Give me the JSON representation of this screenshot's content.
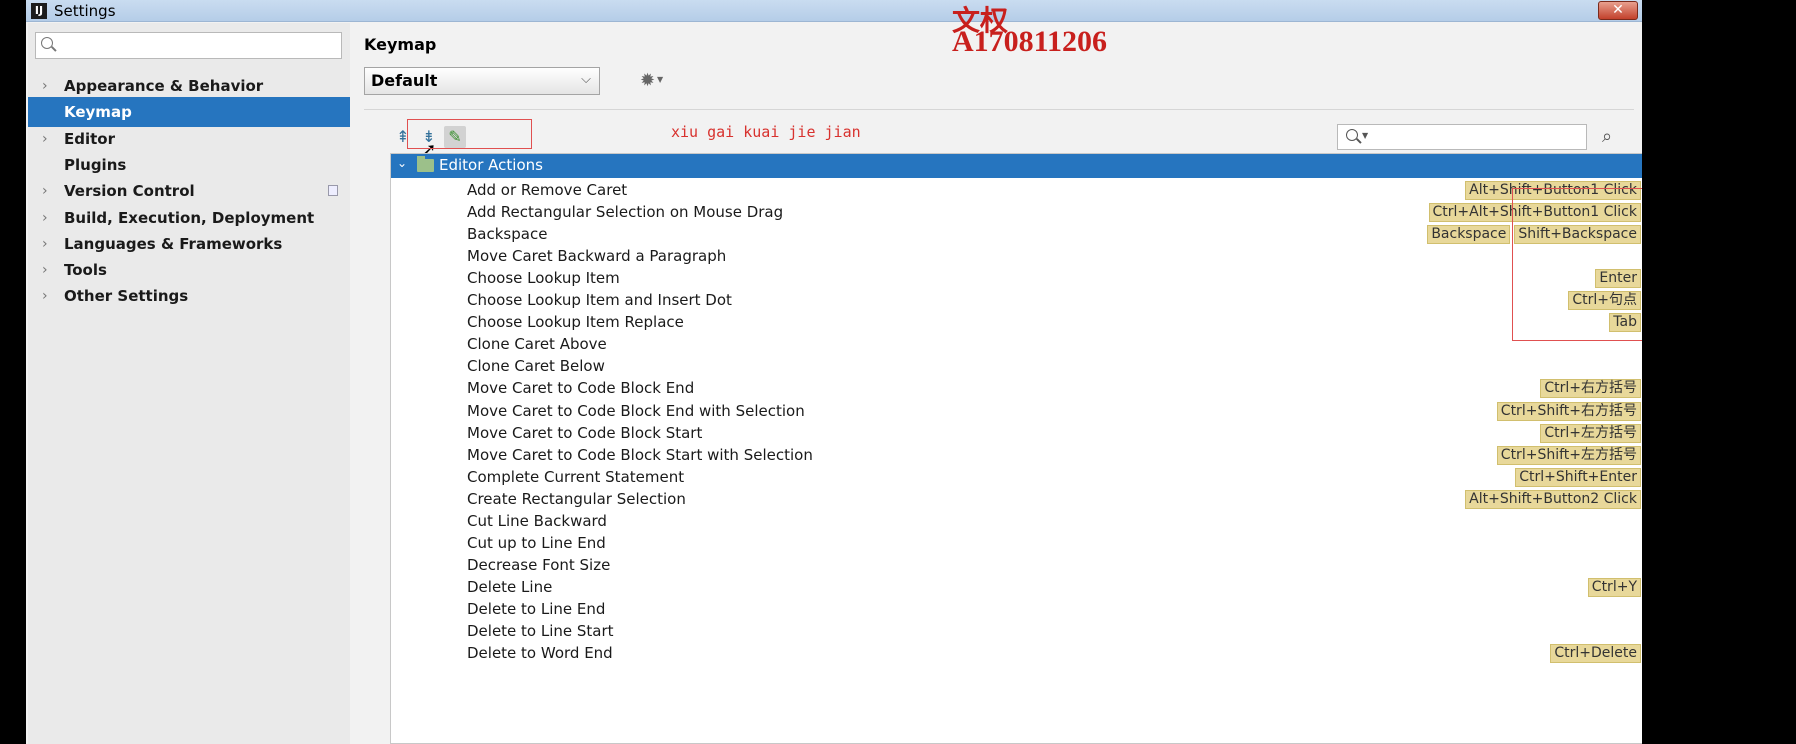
{
  "window": {
    "title": "Settings",
    "app_icon": "IJ",
    "close_glyph": "✕"
  },
  "sidebar": {
    "search_placeholder": "",
    "items": [
      {
        "label": "Appearance & Behavior",
        "expandable": true
      },
      {
        "label": "Keymap",
        "expandable": false,
        "selected": true
      },
      {
        "label": "Editor",
        "expandable": true
      },
      {
        "label": "Plugins",
        "expandable": false
      },
      {
        "label": "Version Control",
        "expandable": true
      },
      {
        "label": "Build, Execution, Deployment",
        "expandable": true
      },
      {
        "label": "Languages & Frameworks",
        "expandable": true
      },
      {
        "label": "Tools",
        "expandable": true
      },
      {
        "label": "Other Settings",
        "expandable": true
      }
    ]
  },
  "content": {
    "heading": "Keymap",
    "scheme_value": "Default",
    "annotation": "xiu gai kuai jie jian",
    "watermark_line1": "文权",
    "watermark_line2": "A170811206",
    "filter_placeholder": "",
    "root_node": "Editor Actions"
  },
  "actions": [
    {
      "name": "Add or Remove Caret",
      "shortcuts": [
        "Alt+Shift+Button1 Click"
      ]
    },
    {
      "name": "Add Rectangular Selection on Mouse Drag",
      "shortcuts": [
        "Ctrl+Alt+Shift+Button1 Click"
      ]
    },
    {
      "name": "Backspace",
      "shortcuts": [
        "Backspace",
        "Shift+Backspace"
      ]
    },
    {
      "name": "Move Caret Backward a Paragraph",
      "shortcuts": []
    },
    {
      "name": "Choose Lookup Item",
      "shortcuts": [
        "Enter"
      ]
    },
    {
      "name": "Choose Lookup Item and Insert Dot",
      "shortcuts": [
        "Ctrl+句点"
      ]
    },
    {
      "name": "Choose Lookup Item Replace",
      "shortcuts": [
        "Tab"
      ]
    },
    {
      "name": "Clone Caret Above",
      "shortcuts": []
    },
    {
      "name": "Clone Caret Below",
      "shortcuts": []
    },
    {
      "name": "Move Caret to Code Block End",
      "shortcuts": [
        "Ctrl+右方括号"
      ]
    },
    {
      "name": "Move Caret to Code Block End with Selection",
      "shortcuts": [
        "Ctrl+Shift+右方括号"
      ]
    },
    {
      "name": "Move Caret to Code Block Start",
      "shortcuts": [
        "Ctrl+左方括号"
      ]
    },
    {
      "name": "Move Caret to Code Block Start with Selection",
      "shortcuts": [
        "Ctrl+Shift+左方括号"
      ]
    },
    {
      "name": "Complete Current Statement",
      "shortcuts": [
        "Ctrl+Shift+Enter"
      ]
    },
    {
      "name": "Create Rectangular Selection",
      "shortcuts": [
        "Alt+Shift+Button2 Click"
      ]
    },
    {
      "name": "Cut Line Backward",
      "shortcuts": []
    },
    {
      "name": "Cut up to Line End",
      "shortcuts": []
    },
    {
      "name": "Decrease Font Size",
      "shortcuts": []
    },
    {
      "name": "Delete Line",
      "shortcuts": [
        "Ctrl+Y"
      ]
    },
    {
      "name": "Delete to Line End",
      "shortcuts": []
    },
    {
      "name": "Delete to Line Start",
      "shortcuts": []
    },
    {
      "name": "Delete to Word End",
      "shortcuts": [
        "Ctrl+Delete"
      ]
    }
  ],
  "colors": {
    "selection": "#2675bf",
    "shortcut_badge": "#e8d89a",
    "annotation_red": "#d8322e"
  }
}
